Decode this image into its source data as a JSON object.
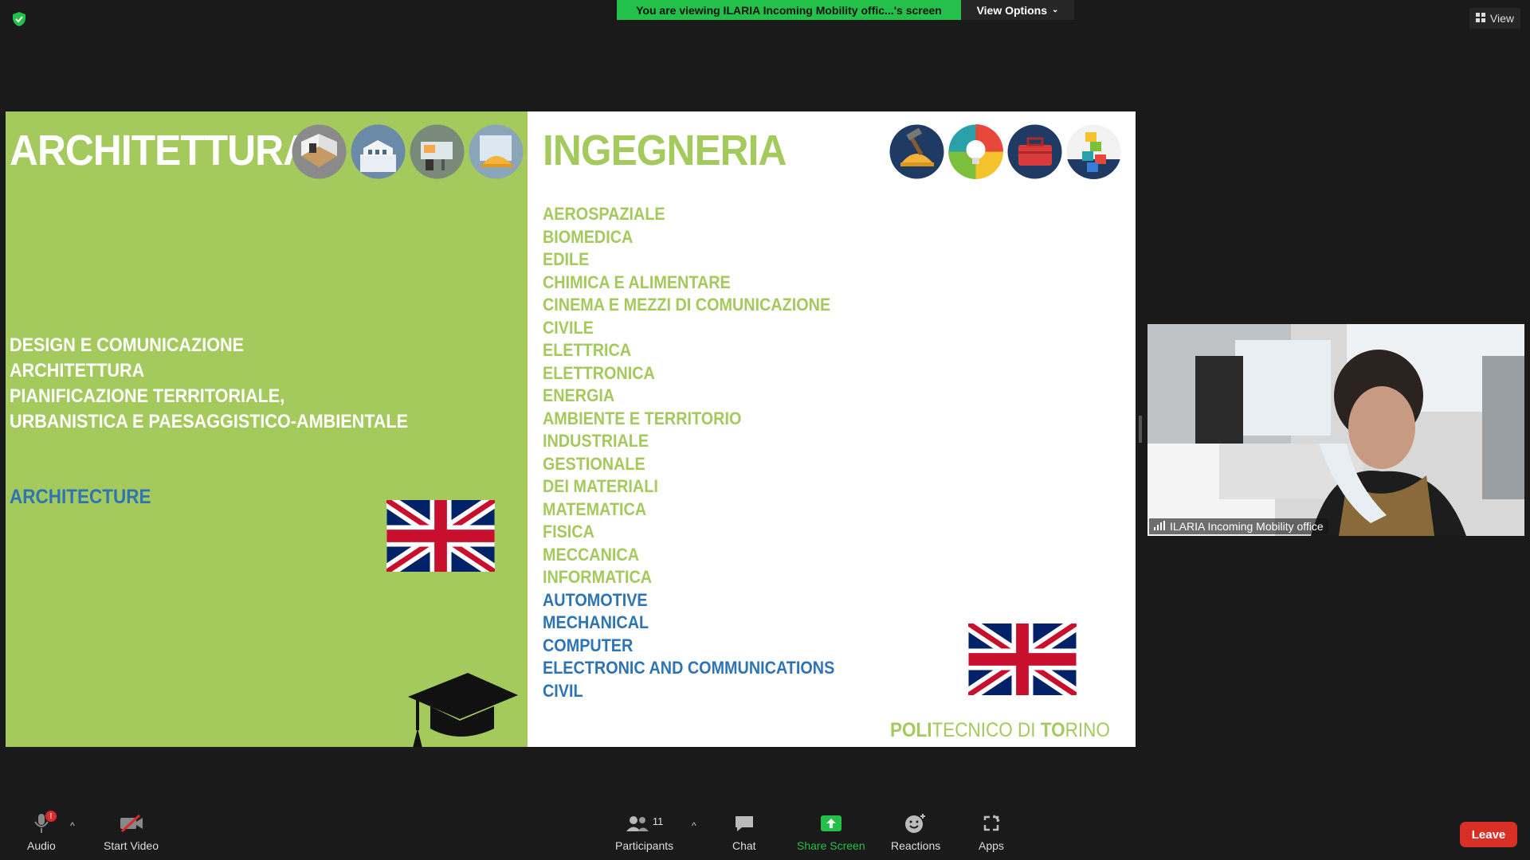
{
  "top": {
    "viewing_banner": "You are viewing ILARIA Incoming Mobility offic...'s screen",
    "view_options": "View Options",
    "view": "View"
  },
  "slide": {
    "left_title": "ARCHITETTURA",
    "left_items": [
      "DESIGN E COMUNICAZIONE",
      "ARCHITETTURA",
      "PIANIFICAZIONE TERRITORIALE,",
      "URBANISTICA E PAESAGGISTICO-AMBIENTALE"
    ],
    "left_english": "ARCHITECTURE",
    "right_title": "INGEGNERIA",
    "right_items_it": [
      "AEROSPAZIALE",
      "BIOMEDICA",
      "EDILE",
      "CHIMICA E ALIMENTARE",
      "CINEMA E MEZZI DI COMUNICAZIONE",
      "CIVILE",
      "ELETTRICA",
      "ELETTRONICA",
      "ENERGIA",
      "AMBIENTE E TERRITORIO",
      "INDUSTRIALE",
      "GESTIONALE",
      "DEI MATERIALI",
      "MATEMATICA",
      "FISICA",
      "MECCANICA",
      "INFORMATICA"
    ],
    "right_items_en": [
      "AUTOMOTIVE",
      "MECHANICAL",
      "COMPUTER",
      "ELECTRONIC AND COMMUNICATIONS",
      "CIVIL"
    ],
    "polito_parts": [
      "POLI",
      "TECNICO DI ",
      "TO",
      "RINO"
    ],
    "colors": {
      "green": "#a4c95c",
      "blue": "#2e74b5"
    }
  },
  "video": {
    "participant_name": "ILARIA Incoming Mobility office"
  },
  "toolbar": {
    "audio": "Audio",
    "start_video": "Start Video",
    "participants": "Participants",
    "participants_count": "11",
    "chat": "Chat",
    "share_screen": "Share Screen",
    "reactions": "Reactions",
    "apps": "Apps",
    "leave": "Leave",
    "audio_badge": "!"
  }
}
